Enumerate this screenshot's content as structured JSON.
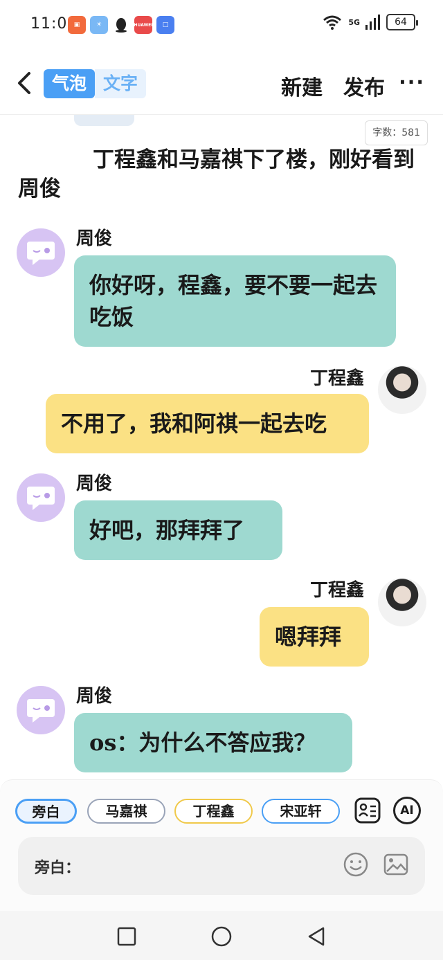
{
  "status_bar": {
    "time": "11:09",
    "network": "5G",
    "battery": "64",
    "app_icons": [
      {
        "name": "kuaishou-icon",
        "color": "#f26a3c",
        "glyph": "▣"
      },
      {
        "name": "weather-icon",
        "color": "#7ab8f5",
        "glyph": "☀"
      },
      {
        "name": "qq-icon",
        "color": "#ffffff",
        "glyph": ""
      },
      {
        "name": "huawei-appgallery-icon",
        "color": "#e94a4a",
        "glyph": "HUAWEI"
      },
      {
        "name": "browser-icon",
        "color": "#4a7ff0",
        "glyph": "□"
      }
    ]
  },
  "header": {
    "mode_bubble": "气泡",
    "mode_text": "文字",
    "new_label": "新建",
    "publish_label": "发布",
    "more_label": "···"
  },
  "content": {
    "word_count": "字数：581",
    "narration": "丁程鑫和马嘉祺下了楼，刚好看到周俊",
    "messages": [
      {
        "speaker": "周俊",
        "text": "你好呀，程鑫，要不要一起去吃饭"
      },
      {
        "speaker": "丁程鑫",
        "text": "不用了，我和阿祺一起去吃"
      },
      {
        "speaker": "周俊",
        "text": "好吧，那拜拜了"
      },
      {
        "speaker": "丁程鑫",
        "text": "嗯拜拜"
      },
      {
        "speaker": "周俊",
        "text": "os：为什么不答应我？"
      }
    ]
  },
  "composer": {
    "chips": [
      "旁白",
      "马嘉祺",
      "丁程鑫",
      "宋亚轩"
    ],
    "chip_colors": [
      "#4a9ff5",
      "#9aa4b8",
      "#f0c94a",
      "#4a9ff5"
    ],
    "ai_label": "AI",
    "input_label": "旁白："
  },
  "colors": {
    "teal_bubble": "#9ed9d0",
    "yellow_bubble": "#fbe184",
    "accent": "#4a9ff5"
  }
}
